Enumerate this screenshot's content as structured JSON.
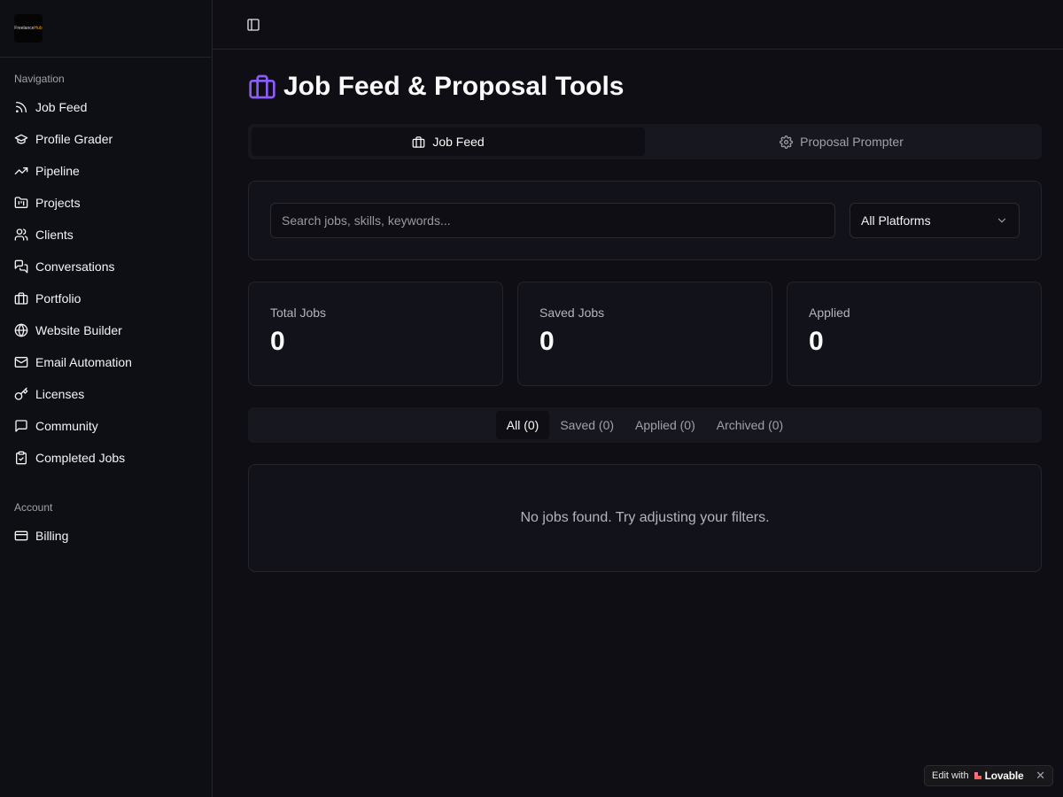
{
  "app": {
    "logo_text_main": "Freelance",
    "logo_text_accent": "Hub"
  },
  "sidebar": {
    "nav_label": "Navigation",
    "nav_items": [
      {
        "label": "Job Feed",
        "icon": "rss-icon"
      },
      {
        "label": "Profile Grader",
        "icon": "graduation-cap-icon"
      },
      {
        "label": "Pipeline",
        "icon": "trending-up-icon"
      },
      {
        "label": "Projects",
        "icon": "folder-kanban-icon"
      },
      {
        "label": "Clients",
        "icon": "users-icon"
      },
      {
        "label": "Conversations",
        "icon": "messages-icon"
      },
      {
        "label": "Portfolio",
        "icon": "briefcase-icon"
      },
      {
        "label": "Website Builder",
        "icon": "globe-icon"
      },
      {
        "label": "Email Automation",
        "icon": "mail-icon"
      },
      {
        "label": "Licenses",
        "icon": "key-icon"
      },
      {
        "label": "Community",
        "icon": "message-square-icon"
      },
      {
        "label": "Completed Jobs",
        "icon": "clipboard-check-icon"
      }
    ],
    "account_label": "Account",
    "account_items": [
      {
        "label": "Billing",
        "icon": "credit-card-icon"
      }
    ]
  },
  "header": {
    "title": "Job Feed & Proposal Tools",
    "title_icon": "briefcase-icon",
    "accent_color": "#8b5cf6"
  },
  "tabs": [
    {
      "label": "Job Feed",
      "icon": "briefcase-icon",
      "active": true
    },
    {
      "label": "Proposal Prompter",
      "icon": "settings-icon",
      "active": false
    }
  ],
  "filters": {
    "search_placeholder": "Search jobs, skills, keywords...",
    "search_value": "",
    "platform_selected": "All Platforms"
  },
  "stats": [
    {
      "label": "Total Jobs",
      "value": "0"
    },
    {
      "label": "Saved Jobs",
      "value": "0"
    },
    {
      "label": "Applied",
      "value": "0"
    }
  ],
  "status_tabs": [
    {
      "label": "All (0)",
      "active": true
    },
    {
      "label": "Saved (0)",
      "active": false
    },
    {
      "label": "Applied (0)",
      "active": false
    },
    {
      "label": "Archived (0)",
      "active": false
    }
  ],
  "empty_state": "No jobs found. Try adjusting your filters.",
  "badge": {
    "prefix": "Edit with",
    "brand": "Lovable",
    "close": "✕"
  }
}
